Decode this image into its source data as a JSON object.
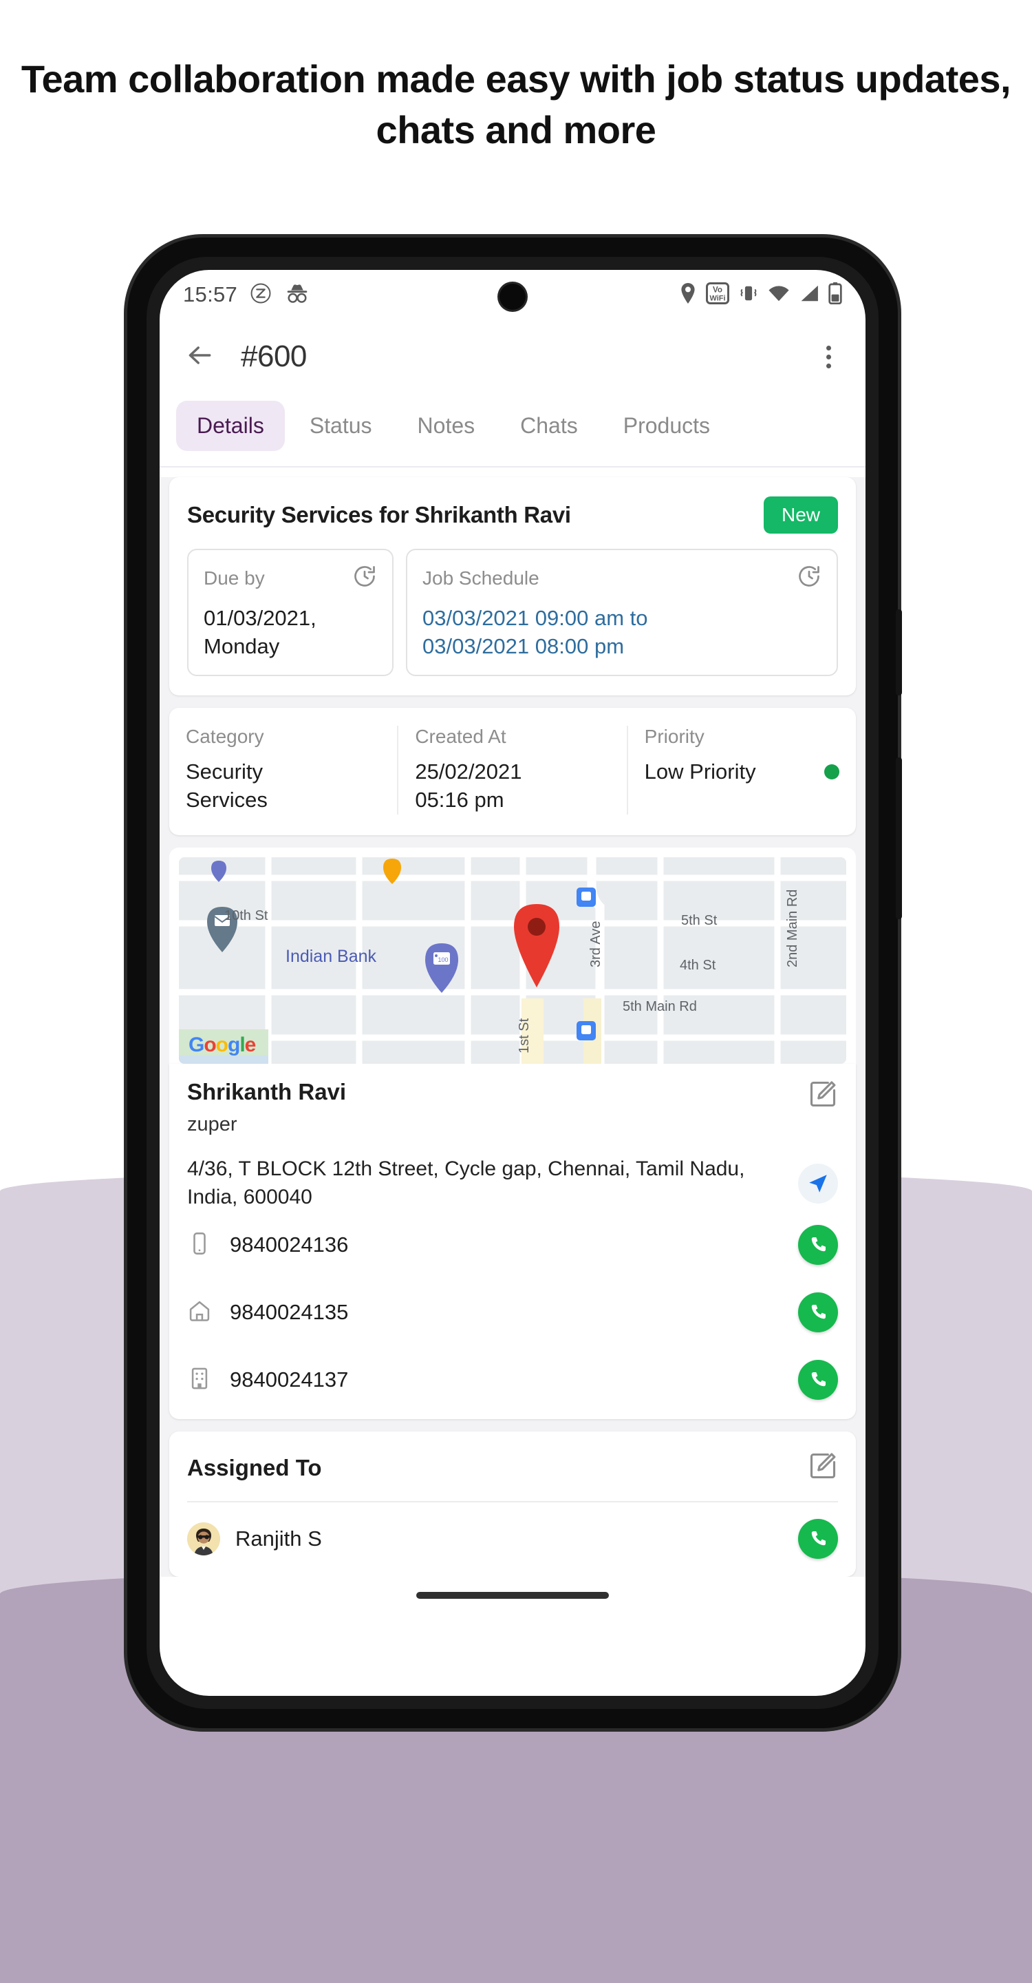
{
  "headline": "Team collaboration made easy with job status updates, chats and more",
  "statusbar": {
    "time": "15:57",
    "icons_left": [
      "zoho-circle-icon",
      "incognito-icon"
    ],
    "icons_right": [
      "location-pin-icon",
      "vowifi-icon",
      "vibrate-icon",
      "wifi-icon",
      "signal-icon",
      "battery-icon"
    ],
    "vowifi_line1": "Vo",
    "vowifi_line2": "WiFi"
  },
  "appbar": {
    "title": "#600",
    "back_icon": "back-arrow-icon",
    "menu_icon": "kebab-menu-icon"
  },
  "tabs": [
    {
      "label": "Details",
      "active": true
    },
    {
      "label": "Status",
      "active": false
    },
    {
      "label": "Notes",
      "active": false
    },
    {
      "label": "Chats",
      "active": false
    },
    {
      "label": "Products",
      "active": false
    }
  ],
  "job": {
    "title": "Security Services for Shrikanth Ravi",
    "status_badge": "New",
    "status_color": "#14b866",
    "due": {
      "label": "Due by",
      "value_line1": "01/03/2021,",
      "value_line2": "Monday",
      "icon": "history-clock-icon"
    },
    "schedule": {
      "label": "Job Schedule",
      "value_line1": "03/03/2021 09:00 am to",
      "value_line2": "03/03/2021 08:00 pm",
      "icon": "history-clock-icon",
      "color": "#2e6d9e"
    }
  },
  "meta": [
    {
      "label": "Category",
      "value_line1": "Security",
      "value_line2": "Services"
    },
    {
      "label": "Created At",
      "value_line1": "25/02/2021",
      "value_line2": "05:16 pm"
    },
    {
      "label": "Priority",
      "value_line1": "Low Priority",
      "value_line2": "",
      "dot_color": "#14a14a"
    }
  ],
  "map": {
    "labels": [
      "10th St",
      "Indian Bank",
      "3rd Ave",
      "5th St",
      "4th St",
      "5th Main Rd",
      "2nd Main Rd",
      "1st St"
    ],
    "street_10th": "10th St",
    "bank": "Indian Bank",
    "ave_3rd": "3rd Ave",
    "st_5th": "5th St",
    "st_4th": "4th St",
    "main_5th": "5th Main Rd",
    "main_2nd": "2nd Main Rd",
    "st_1st": "1st St",
    "bank_badge": "100",
    "logo": [
      "G",
      "o",
      "o",
      "g",
      "l",
      "e"
    ],
    "marker_icon": "map-pin-marker-icon"
  },
  "customer": {
    "name": "Shrikanth Ravi",
    "org": "zuper",
    "address": "4/36, T BLOCK 12th Street, Cycle gap, Chennai, Tamil Nadu, India, 600040",
    "edit_icon": "edit-pencil-icon",
    "navigate_icon": "navigation-arrow-icon",
    "phones": [
      {
        "icon": "mobile-phone-icon",
        "number": "9840024136"
      },
      {
        "icon": "home-icon",
        "number": "9840024135"
      },
      {
        "icon": "office-building-icon",
        "number": "9840024137"
      }
    ],
    "call_icon": "phone-call-icon",
    "call_color": "#16b94e"
  },
  "assigned": {
    "title": "Assigned To",
    "edit_icon": "edit-pencil-icon",
    "people": [
      {
        "name": "Ranjith S",
        "avatar": "user-avatar",
        "call_icon": "phone-call-icon"
      }
    ]
  },
  "nav": {
    "pill": "home-indicator"
  }
}
